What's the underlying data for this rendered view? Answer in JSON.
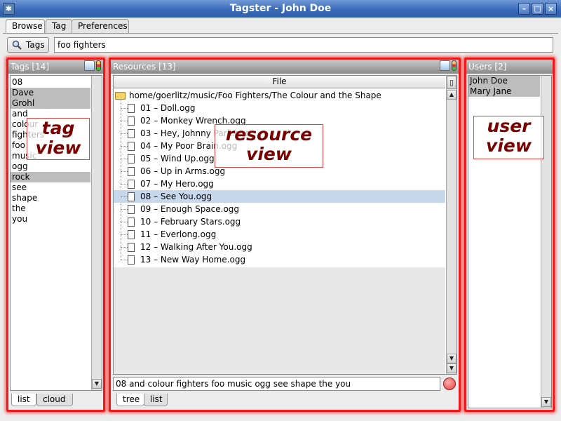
{
  "window": {
    "title": "Tagster - John Doe",
    "app_icon": "app-logo-icon"
  },
  "main_tabs": [
    "Browse",
    "Tag",
    "Preferences"
  ],
  "search": {
    "button_label": "Tags",
    "value": "foo fighters"
  },
  "tag_panel": {
    "header": "Tags [14]",
    "items": [
      {
        "label": "08",
        "selected": false
      },
      {
        "label": "Dave",
        "selected": true
      },
      {
        "label": "Grohl",
        "selected": true
      },
      {
        "label": "and",
        "selected": false
      },
      {
        "label": "colour",
        "selected": false
      },
      {
        "label": "fighters",
        "selected": false
      },
      {
        "label": "foo",
        "selected": false
      },
      {
        "label": "music",
        "selected": false
      },
      {
        "label": "ogg",
        "selected": false
      },
      {
        "label": "rock",
        "selected": true
      },
      {
        "label": "see",
        "selected": false
      },
      {
        "label": "shape",
        "selected": false
      },
      {
        "label": "the",
        "selected": false
      },
      {
        "label": "you",
        "selected": false
      }
    ],
    "bottom_tabs": [
      "list",
      "cloud"
    ],
    "overlay": [
      "tag",
      "view"
    ]
  },
  "resource_panel": {
    "header": "Resources [13]",
    "column_header": "File",
    "root_path": "home/goerlitz/music/Foo Fighters/The Colour and the Shape",
    "files": [
      "01 – Doll.ogg",
      "02 – Monkey Wrench.ogg",
      "03 – Hey, Johnny Park.ogg",
      "04 – My Poor Brain.ogg",
      "05 – Wind Up.ogg",
      "06 – Up in Arms.ogg",
      "07 – My Hero.ogg",
      "08 – See You.ogg",
      "09 – Enough Space.ogg",
      "10 – February Stars.ogg",
      "11 – Everlong.ogg",
      "12 – Walking After You.ogg",
      "13 – New Way Home.ogg"
    ],
    "selected_file": "08 – See You.ogg",
    "status_text": "08 and colour fighters foo music ogg see shape the you",
    "bottom_tabs": [
      "tree",
      "list"
    ],
    "overlay": [
      "resource",
      "view"
    ]
  },
  "user_panel": {
    "header": "Users [2]",
    "users": [
      "John Doe",
      "Mary Jane"
    ],
    "overlay": [
      "user",
      "view"
    ]
  }
}
